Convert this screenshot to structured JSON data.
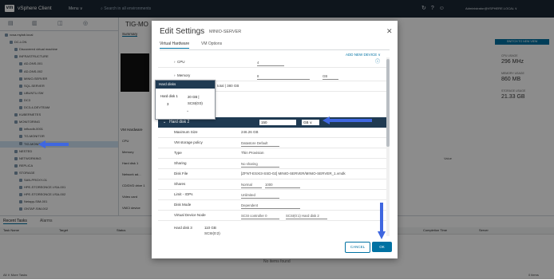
{
  "topbar": {
    "logo": "vm",
    "app_title": "vSphere Client",
    "menu_label": "Menu ∨",
    "search_placeholder": "Search in all environments",
    "user": "Administrator@VSPHERE.LOCAL ∨"
  },
  "nav": {
    "tree": [
      {
        "label": "vcsa.mylab.local",
        "indent": 1,
        "selected": false
      },
      {
        "label": "DC-LON",
        "indent": 2,
        "selected": false
      },
      {
        "label": "Discovered virtual machine",
        "indent": 3,
        "selected": false
      },
      {
        "label": "INFRASTRUCTURE",
        "indent": 3,
        "selected": false
      },
      {
        "label": "AD-DNS-001",
        "indent": 4,
        "selected": false
      },
      {
        "label": "AD-DNS-002",
        "indent": 4,
        "selected": false
      },
      {
        "label": "MINIO-SERVER",
        "indent": 4,
        "selected": false
      },
      {
        "label": "SQL-SERVER",
        "indent": 4,
        "selected": false
      },
      {
        "label": "UBUNTU-SW",
        "indent": 4,
        "selected": false
      },
      {
        "label": "DC3",
        "indent": 4,
        "selected": false
      },
      {
        "label": "DC3-4-DEVTEAM",
        "indent": 4,
        "selected": false
      },
      {
        "label": "KUBERNETES",
        "indent": 3,
        "selected": false
      },
      {
        "label": "MONITORING",
        "indent": 3,
        "selected": false
      },
      {
        "label": "influxdb-0001",
        "indent": 4,
        "selected": false
      },
      {
        "label": "TG-MONITOR",
        "indent": 4,
        "selected": false
      },
      {
        "label": "TIG-MONITOR-01",
        "indent": 4,
        "selected": true
      },
      {
        "label": "NESTED",
        "indent": 3,
        "selected": false
      },
      {
        "label": "NETWORKING",
        "indent": 3,
        "selected": false
      },
      {
        "label": "REPLICA",
        "indent": 3,
        "selected": false
      },
      {
        "label": "STORAGE",
        "indent": 3,
        "selected": false
      },
      {
        "label": "SAN-PROXY-01",
        "indent": 4,
        "selected": false
      },
      {
        "label": "HPE-STOREONCE-VSA-001",
        "indent": 4,
        "selected": false
      },
      {
        "label": "HPE-STOREONCE-VSA-002",
        "indent": 4,
        "selected": false
      },
      {
        "label": "Netapp-SIM-001",
        "indent": 4,
        "selected": false
      },
      {
        "label": "ONTAP-SIM-002",
        "indent": 4,
        "selected": false
      }
    ]
  },
  "main": {
    "title": "TIG-MO",
    "tab_summary": "Summary",
    "panel_button": "SWITCH TO NEW VIEW",
    "stats": [
      {
        "label": "CPU USAGE",
        "value": "296 MHz"
      },
      {
        "label": "MEMORY USAGE",
        "value": "860 MB"
      },
      {
        "label": "STORAGE USAGE",
        "value": "21.33 GB"
      }
    ],
    "vm_hardware": "VM Hardware",
    "hw_rows": [
      "CPU",
      "Memory",
      "Hard disk 1",
      "Network ad...",
      "CD/DVD drive 1",
      "Video card",
      "VMCI device"
    ],
    "col_value": "Value"
  },
  "bottom": {
    "tab_recent": "Recent Tasks",
    "tab_alarms": "Alarms",
    "cols": [
      "Task Name",
      "Target",
      "Status",
      "Completion Time",
      "Server"
    ],
    "empty": "No items found",
    "footer": "All ∨  More Tasks",
    "count": "0 items"
  },
  "modal": {
    "title": "Edit Settings",
    "subtitle": "MINIO-SERVER",
    "tab_hardware": "Virtual Hardware",
    "tab_options": "VM Options",
    "add_device": "ADD NEW DEVICE ∨",
    "rows": {
      "cpu": {
        "label": "CPU",
        "value": "4"
      },
      "memory": {
        "label": "Memory",
        "value": "8",
        "unit": "GB"
      },
      "hd_total": "total | 380 GB",
      "hd2": {
        "label": "Hard disk 2",
        "value": "150",
        "unit": "GB"
      },
      "max_size": {
        "label": "Maximum Size",
        "value": "246.26 GB"
      },
      "storage_policy": {
        "label": "VM storage policy",
        "value": "Datastore Default"
      },
      "type": {
        "label": "Type",
        "value": "Thin Provision"
      },
      "sharing": {
        "label": "Sharing",
        "value": "No sharing"
      },
      "disk_file": {
        "label": "Disk File",
        "value": "[ZFNT-ESXI3-SSD-02] MINIO-SERVER/MINIO-SERVER_1.vmdk"
      },
      "shares": {
        "label": "Shares",
        "value": "Normal",
        "num": "1000"
      },
      "limit_iops": {
        "label": "Limit - IOPs",
        "value": "Unlimited"
      },
      "disk_mode": {
        "label": "Disk Mode",
        "value": "Dependent"
      },
      "vdev_node": {
        "label": "Virtual Device Node",
        "value": "SCSI controller 0",
        "value2": "SCSI(0:1) Hard disk 2"
      },
      "hd3": {
        "label": "Hard disk 3",
        "value": "110 GB",
        "sub": "SCSI(0:2)"
      }
    },
    "tooltip": {
      "header": "Hard disks",
      "item_label": "Hard disk 1",
      "item_size": "20 GB |",
      "item_node": "SCSI(0:0)",
      "count": "3"
    },
    "cancel": "CANCEL",
    "ok": "OK"
  },
  "colors": {
    "accent": "#0072a3",
    "arrow": "#3f67e0",
    "header_dark": "#1f3a52"
  }
}
